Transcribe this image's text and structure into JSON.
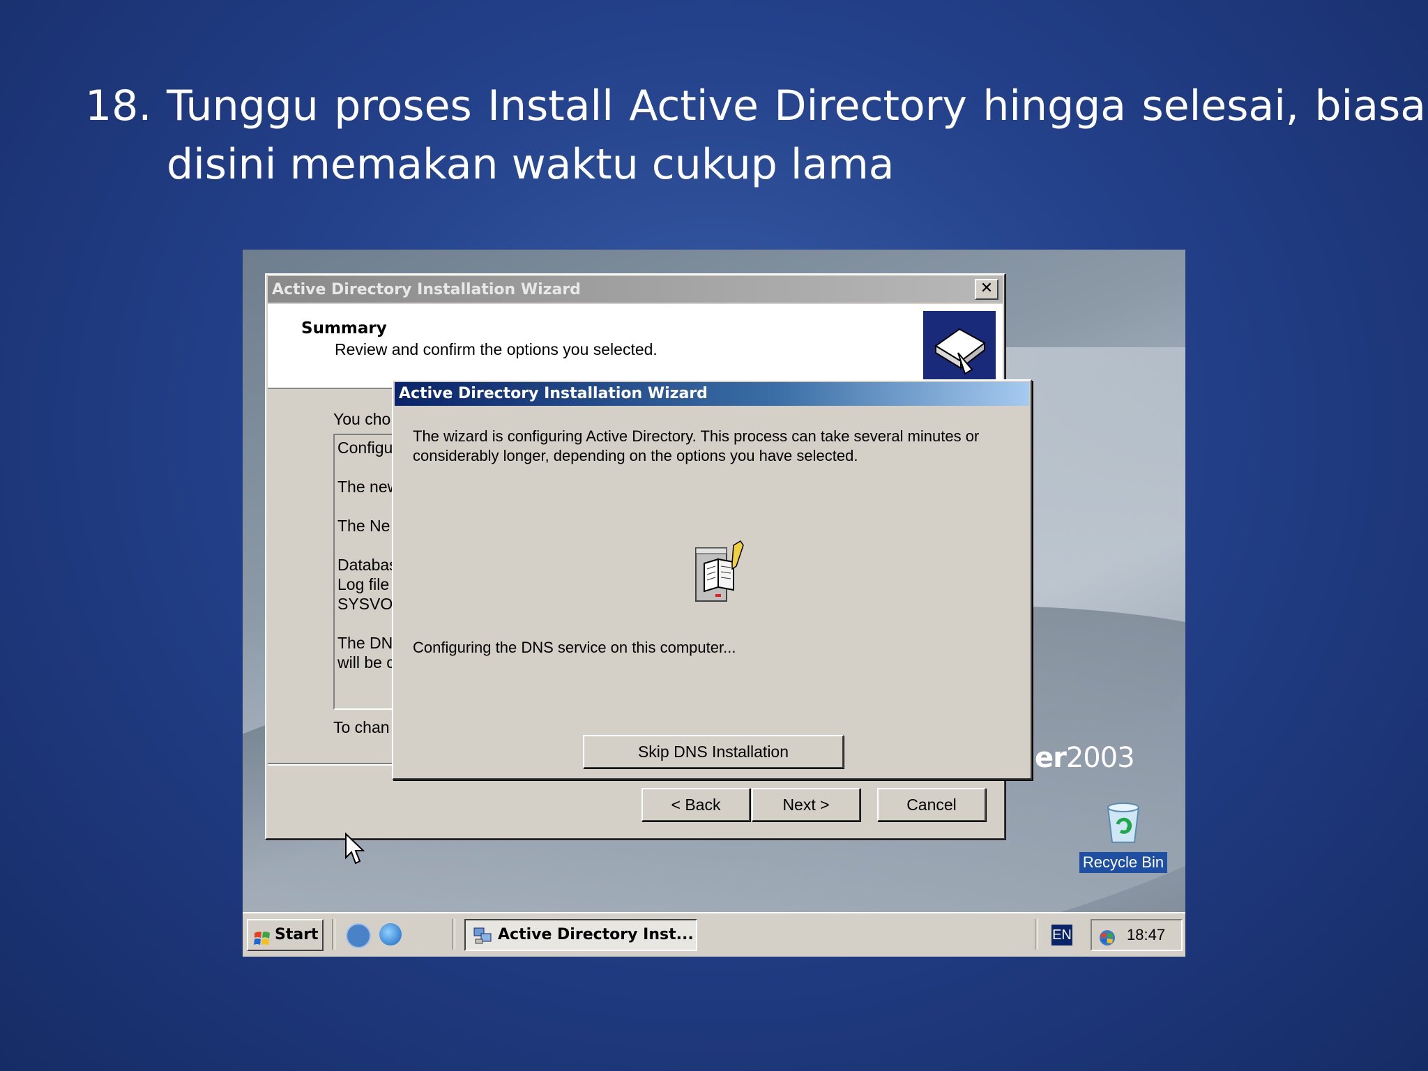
{
  "slide": {
    "number": "18.",
    "line1": "Tunggu proses Install Active Directory hingga selesai, biasa",
    "line2": "disini memakan waktu cukup lama"
  },
  "desktop": {
    "brand_bold": "er",
    "brand_year": "2003",
    "recycle_bin_label": "Recycle Bin"
  },
  "background_wizard": {
    "title": "Active Directory Installation Wizard",
    "close_glyph": "✕",
    "header_title": "Summary",
    "header_subtitle": "Review and confirm the options you selected.",
    "body_label": "You cho",
    "summary_lines": [
      "Configu",
      "",
      "The new",
      "",
      "The Ne",
      "",
      "Databas",
      "Log file",
      "SYSVOL",
      "",
      "The DN",
      "will be c"
    ],
    "change_text": "To chan",
    "buttons": {
      "back": "< Back",
      "next": "Next >",
      "cancel": "Cancel"
    }
  },
  "progress_dialog": {
    "title": "Active Directory Installation Wizard",
    "message": "The wizard is configuring Active Directory. This process can take several minutes or considerably longer, depending on the options you have selected.",
    "status": "Configuring the DNS service on this computer...",
    "skip_button": "Skip DNS Installation"
  },
  "taskbar": {
    "start_label": "Start",
    "task_button": "Active Directory Inst...",
    "language": "EN",
    "clock": "18:47"
  }
}
